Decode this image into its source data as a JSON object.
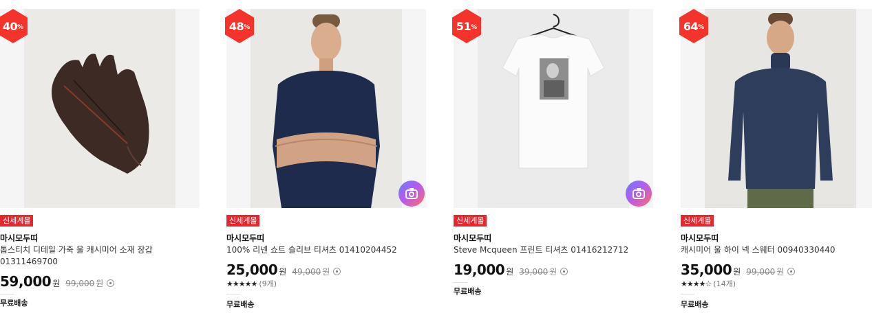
{
  "products": [
    {
      "discount": "40",
      "discount_unit": "%",
      "badge": "신세계몰",
      "brand": "마시모두띠",
      "name": "톱스티치 디테일 가죽 울 캐시미어 소재 장갑 01311469700",
      "price": "59,000",
      "currency": "원",
      "original_price": "99,000",
      "shipping": "무료배송",
      "image_icon": "leather-gloves-photo"
    },
    {
      "discount": "48",
      "discount_unit": "%",
      "badge": "신세계몰",
      "brand": "마시모두띠",
      "name": "100% 리넨 쇼트 슬리브 티셔츠 01410204452",
      "price": "25,000",
      "currency": "원",
      "original_price": "49,000",
      "rating_stars": 5,
      "review_count": "(9개)",
      "shipping": "무료배송",
      "image_icon": "navy-linen-tshirt-model-photo",
      "camera_icon": "camera-icon"
    },
    {
      "discount": "51",
      "discount_unit": "%",
      "badge": "신세계몰",
      "brand": "마시모두띠",
      "name": "Steve Mcqueen 프린트 티셔츠 01416212712",
      "price": "19,000",
      "currency": "원",
      "original_price": "39,000",
      "shipping": "무료배송",
      "image_icon": "white-print-tshirt-hanger-photo",
      "camera_icon": "camera-icon"
    },
    {
      "discount": "64",
      "discount_unit": "%",
      "badge": "신세계몰",
      "brand": "마시모두띠",
      "name": "캐시미어 울 하이 넥 스웨터 00940330440",
      "price": "35,000",
      "currency": "원",
      "original_price": "99,000",
      "rating_stars": 4.5,
      "review_count": "(14개)",
      "shipping": "무료배송",
      "image_icon": "navy-turtleneck-model-photo"
    }
  ],
  "colors": {
    "discount_badge": "#f4332a",
    "store_badge": "#e5272e"
  }
}
